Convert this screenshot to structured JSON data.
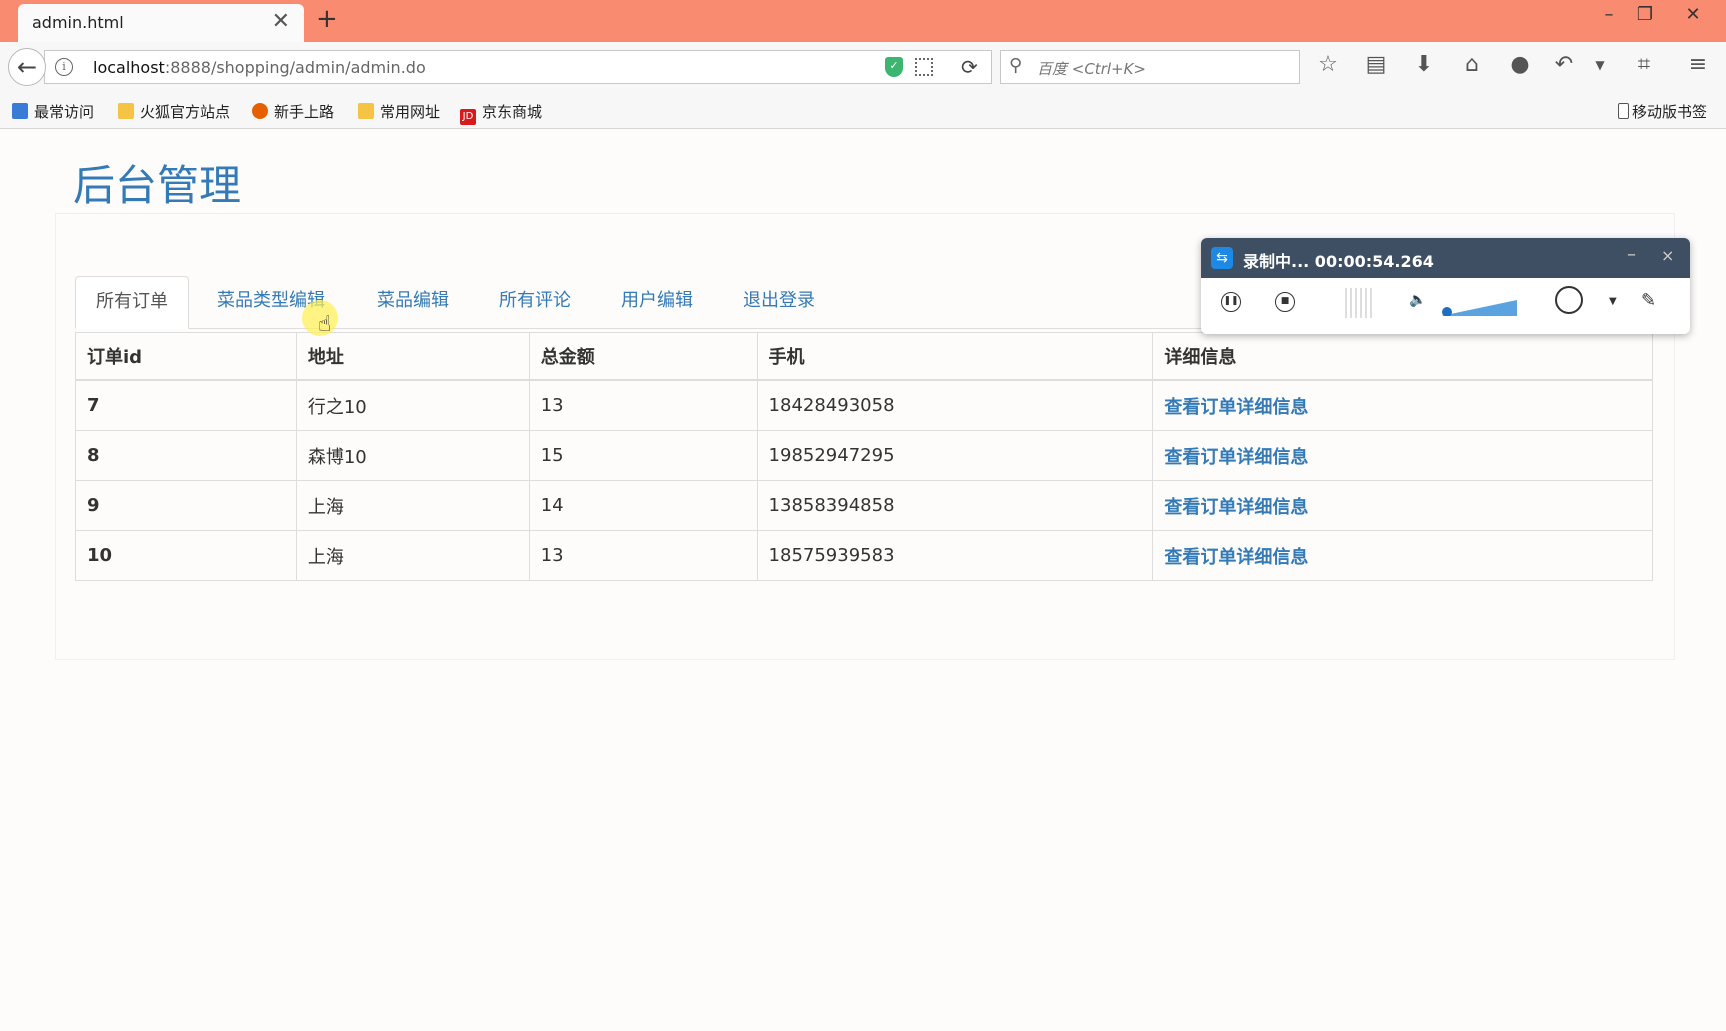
{
  "browser": {
    "tab_title": "admin.html",
    "tab_close": "✕",
    "new_tab": "+",
    "url_host": "localhost",
    "url_path": ":8888/shopping/admin/admin.do",
    "search_placeholder": "百度 <Ctrl+K>",
    "bookmarks": [
      {
        "label": "最常访问",
        "color": "#3a7bd5"
      },
      {
        "label": "火狐官方站点",
        "color": "#f6c445"
      },
      {
        "label": "新手上路",
        "color": "#e66000"
      },
      {
        "label": "常用网址",
        "color": "#f6c445"
      },
      {
        "label": "京东商城",
        "color": "#d71a1a"
      }
    ],
    "mobile_bookmarks": "移动版书签",
    "jd_icon_text": "JD"
  },
  "page": {
    "title": "后台管理",
    "tabs": [
      {
        "label": "所有订单",
        "active": true
      },
      {
        "label": "菜品类型编辑",
        "active": false
      },
      {
        "label": "菜品编辑",
        "active": false
      },
      {
        "label": "所有评论",
        "active": false
      },
      {
        "label": "用户编辑",
        "active": false
      },
      {
        "label": "退出登录",
        "active": false
      }
    ],
    "table": {
      "headers": [
        "订单id",
        "地址",
        "总金额",
        "手机",
        "详细信息"
      ],
      "rows": [
        {
          "id": "7",
          "address": "行之10",
          "total": "13",
          "phone": "18428493058",
          "detail": "查看订单详细信息"
        },
        {
          "id": "8",
          "address": "森博10",
          "total": "15",
          "phone": "19852947295",
          "detail": "查看订单详细信息"
        },
        {
          "id": "9",
          "address": "上海",
          "total": "14",
          "phone": "13858394858",
          "detail": "查看订单详细信息"
        },
        {
          "id": "10",
          "address": "上海",
          "total": "13",
          "phone": "18575939583",
          "detail": "查看订单详细信息"
        }
      ]
    }
  },
  "recorder": {
    "title": "录制中...  00:00:54.264",
    "minimize": "–",
    "close": "×"
  },
  "colors": {
    "titlebar": "#f98b70",
    "link": "#337ab7",
    "recorder_header": "#3e4e63"
  }
}
